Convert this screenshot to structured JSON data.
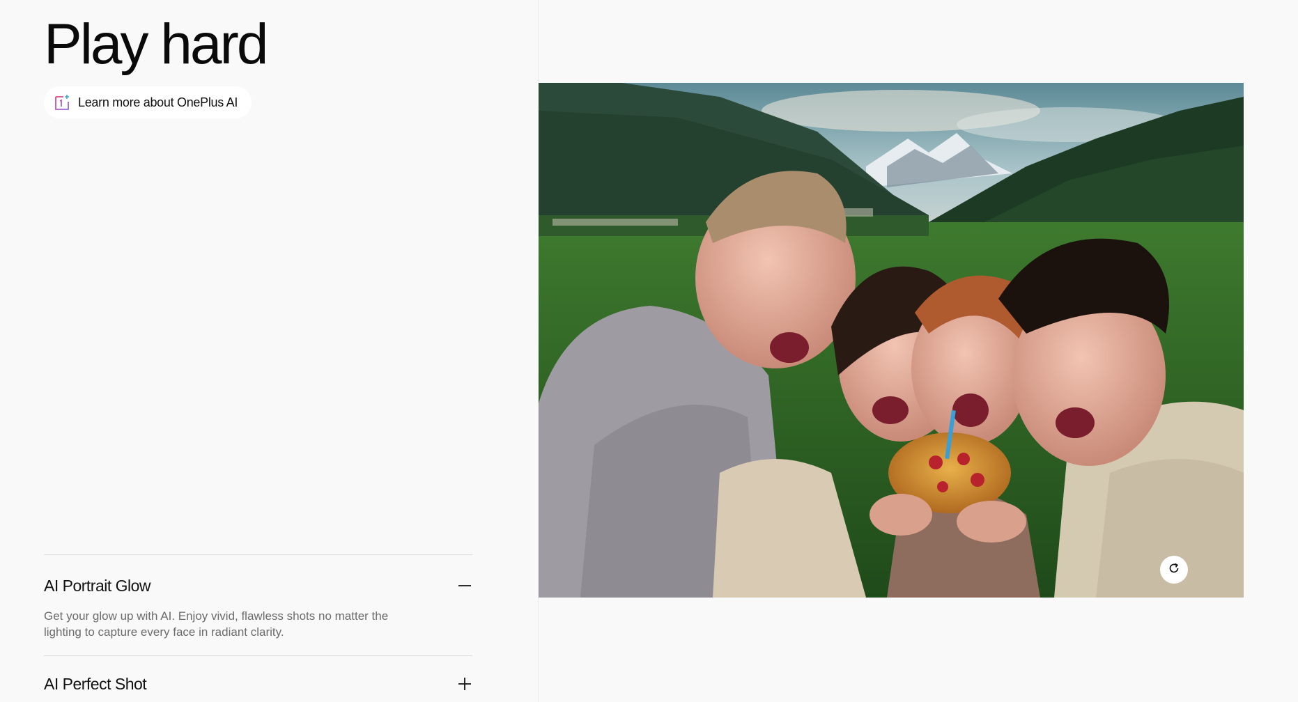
{
  "headline": "Play hard",
  "learn_more": {
    "label": "Learn more about OnePlus AI",
    "icon": "oneplus-ai-logo-icon"
  },
  "features": [
    {
      "title": "AI Portrait Glow",
      "description": "Get your glow up with AI. Enjoy vivid, flawless shots no matter the lighting to capture every face in radiant clarity.",
      "expanded": true,
      "toggle_icon": "minus-icon"
    },
    {
      "title": "AI Perfect Shot",
      "expanded": false,
      "toggle_icon": "plus-icon"
    }
  ],
  "media": {
    "replay_icon": "replay-icon"
  },
  "colors": {
    "background": "#f9f9f9",
    "text": "#111111",
    "muted_text": "#6b6b6b",
    "divider": "#dcdcdc",
    "pill_background": "#ffffff"
  }
}
